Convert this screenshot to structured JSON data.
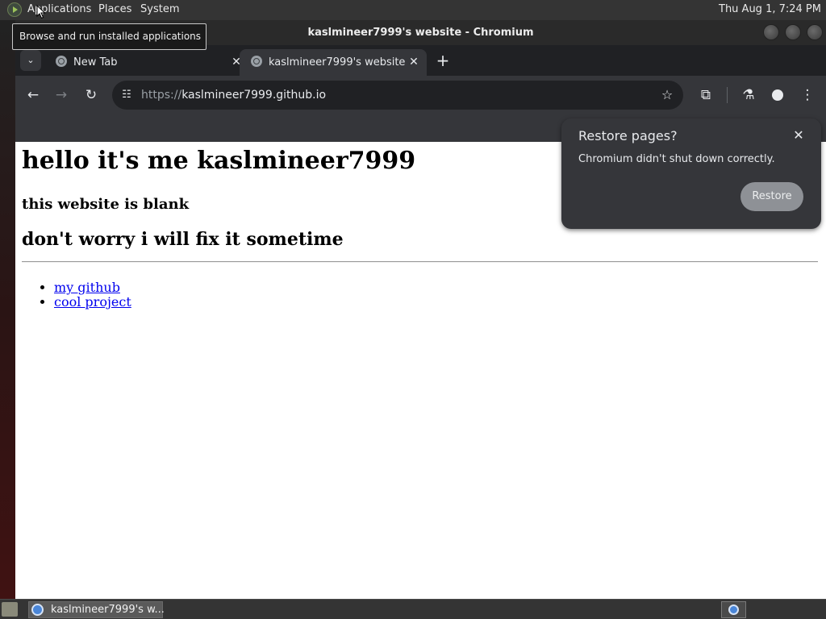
{
  "top_panel": {
    "menus": [
      "Applications",
      "Places",
      "System"
    ],
    "clock": "Thu Aug  1,  7:24 PM"
  },
  "tooltip": "Browse and run installed applications",
  "window": {
    "title": "kaslmineer7999's website - Chromium"
  },
  "tabs": [
    {
      "label": "New Tab",
      "icon": "globe-icon"
    },
    {
      "label": "kaslmineer7999's website",
      "icon": "globe-icon"
    }
  ],
  "omnibox": {
    "scheme": "https://",
    "host": "kaslmineer7999.github.io"
  },
  "page": {
    "h1": "hello it's me kaslmineer7999",
    "h3": "this website is blank",
    "h2": "don't worry i will fix it sometime",
    "links": [
      "my github",
      "cool project"
    ]
  },
  "restore_bubble": {
    "title": "Restore pages?",
    "message": "Chromium didn't shut down correctly.",
    "button": "Restore"
  },
  "taskbar": {
    "item_label": "kaslmineer7999's w..."
  }
}
